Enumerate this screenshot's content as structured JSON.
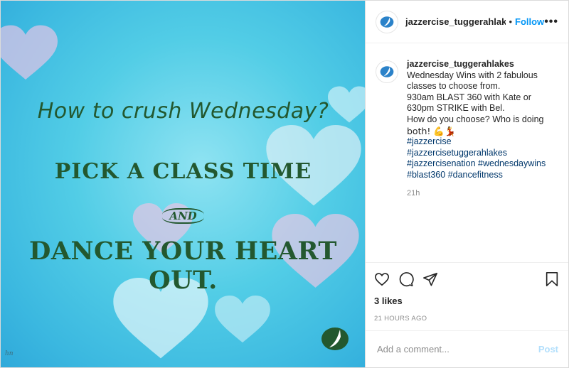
{
  "image": {
    "headline": "How to crush Wednesday?",
    "pick_line": "PICK A CLASS TIME",
    "and_word": "AND",
    "dance_line": "DANCE YOUR HEART OUT.",
    "signature": "hn",
    "brand_color": "#23582f",
    "background_color": "#4fcbe6"
  },
  "header": {
    "username": "jazzercise_tuggerahlake",
    "separator": "•",
    "follow_label": "Follow",
    "more_label": "•••",
    "avatar_icon": "jazzercise-logo-icon"
  },
  "caption": {
    "username": "jazzercise_tuggerahlakes",
    "lines": [
      "Wednesday Wins with 2 fabulous",
      "classes to choose from.",
      "930am BLAST 360 with Kate or",
      "630pm STRIKE with Bel.",
      "How do you choose? Who is doing",
      "both! 💪💃"
    ],
    "hashtags": [
      "#jazzercise",
      "#jazzercisetuggerahlakes",
      "#jazzercisenation #wednesdaywins",
      "#blast360 #dancefitness"
    ],
    "time": "21h"
  },
  "actions": {
    "icons": [
      "heart-icon",
      "comment-icon",
      "share-icon",
      "bookmark-icon"
    ],
    "likes": "3 likes",
    "date": "21 HOURS AGO"
  },
  "comment": {
    "placeholder": "Add a comment...",
    "post_label": "Post",
    "post_color": "#b2dffc"
  },
  "colors": {
    "link": "#0095f6",
    "hashtag": "#00376b",
    "muted": "#8e8e8e"
  }
}
